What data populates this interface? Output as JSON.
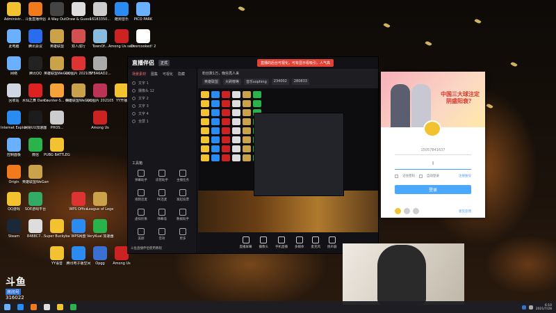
{
  "desktop": {
    "icons": [
      {
        "label": "Administr...",
        "color": "#f2c230",
        "col": 0,
        "row": 0
      },
      {
        "label": "斗鱼直播伴侣",
        "color": "#f07a1c",
        "col": 1,
        "row": 0
      },
      {
        "label": "A Way Out",
        "color": "#444",
        "col": 2,
        "row": 0
      },
      {
        "label": "Draw & Guess",
        "color": "#ddd",
        "col": 3,
        "row": 0
      },
      {
        "label": "16183350...",
        "color": "#ccc",
        "col": 4,
        "row": 0
      },
      {
        "label": "酷狗音乐",
        "color": "#2a8cf0",
        "col": 5,
        "row": 0
      },
      {
        "label": "PICO PARK",
        "color": "#6ab0ff",
        "col": 6,
        "row": 0
      },
      {
        "label": "此电脑",
        "color": "#6ab0ff",
        "col": 0,
        "row": 1
      },
      {
        "label": "腾讯会议",
        "color": "#2a6cf0",
        "col": 1,
        "row": 1
      },
      {
        "label": "英雄联盟",
        "color": "#c9a24a",
        "col": 2,
        "row": 1
      },
      {
        "label": "双人成行",
        "color": "#d35050",
        "col": 3,
        "row": 1
      },
      {
        "label": "TownOf...",
        "color": "#8bd",
        "col": 4,
        "row": 1
      },
      {
        "label": "Among Us sentian",
        "color": "#c22",
        "col": 5,
        "row": 1
      },
      {
        "label": "Overcooked! 2",
        "color": "#fff",
        "col": 6,
        "row": 1
      },
      {
        "label": "网络",
        "color": "#6ab0ff",
        "col": 0,
        "row": 2
      },
      {
        "label": "腾讯QQ",
        "color": "#222",
        "col": 1,
        "row": 2
      },
      {
        "label": "英雄联盟WeGame版",
        "color": "#c9a24a",
        "col": 2,
        "row": 2
      },
      {
        "label": "QQ图片 20210S...",
        "color": "#d33",
        "col": 3,
        "row": 2
      },
      {
        "label": "5F8A6AD2...",
        "color": "#aaa",
        "col": 4,
        "row": 2
      },
      {
        "label": "回收站",
        "color": "#cfd8e0",
        "col": 0,
        "row": 3
      },
      {
        "label": "水仙之舞 Dance of F...",
        "color": "#d22",
        "col": 1,
        "row": 3
      },
      {
        "label": "Counter-S... Global Of...",
        "color": "#f6a23a",
        "col": 2,
        "row": 3
      },
      {
        "label": "英雄联盟WeGame...",
        "color": "#c9a24a",
        "col": 3,
        "row": 3
      },
      {
        "label": "QQ图片 2021050...",
        "color": "#b35",
        "col": 4,
        "row": 3
      },
      {
        "label": "YY开播",
        "color": "#f2c230",
        "col": 5,
        "row": 3
      },
      {
        "label": "Internet Explorer",
        "color": "#2a8cf0",
        "col": 0,
        "row": 4
      },
      {
        "label": "网易UU加速器",
        "color": "#1c1c1c",
        "col": 1,
        "row": 4
      },
      {
        "label": "PHOS...",
        "color": "#ccc",
        "col": 2,
        "row": 4
      },
      {
        "label": "Among Us",
        "color": "#c22",
        "col": 4,
        "row": 4
      },
      {
        "label": "控制面板",
        "color": "#6ab0ff",
        "col": 0,
        "row": 5
      },
      {
        "label": "微信",
        "color": "#2ab34a",
        "col": 1,
        "row": 5
      },
      {
        "label": "PUBG BATTLEG...",
        "color": "#f2c230",
        "col": 2,
        "row": 5
      },
      {
        "label": "Origin",
        "color": "#f07a1c",
        "col": 0,
        "row": 6
      },
      {
        "label": "英雄联盟WeGame版",
        "color": "#c9a24a",
        "col": 1,
        "row": 6
      },
      {
        "label": "QQ游戏",
        "color": "#f2c230",
        "col": 0,
        "row": 7
      },
      {
        "label": "SOE游戏平台",
        "color": "#3a6",
        "col": 1,
        "row": 7
      },
      {
        "label": "WPS Office",
        "color": "#d33",
        "col": 3,
        "row": 7
      },
      {
        "label": "League of Legends",
        "color": "#c9a24a",
        "col": 4,
        "row": 7
      },
      {
        "label": "Steam",
        "color": "#1b2838",
        "col": 0,
        "row": 8
      },
      {
        "label": "8488C7...",
        "color": "#ddd",
        "col": 1,
        "row": 8
      },
      {
        "label": "Super Buckyball...",
        "color": "#f2c230",
        "col": 2,
        "row": 8
      },
      {
        "label": "WPS网盘",
        "color": "#2a8cf0",
        "col": 3,
        "row": 8
      },
      {
        "label": "VeryKuai 加速器",
        "color": "#2ab34a",
        "col": 4,
        "row": 8
      },
      {
        "label": "YY语音",
        "color": "#f2c230",
        "col": 2,
        "row": 9
      },
      {
        "label": "腾讯电子版空间",
        "color": "#2a8cf0",
        "col": 3,
        "row": 9
      },
      {
        "label": "Opgg",
        "color": "#3b6fd1",
        "col": 4,
        "row": 9
      },
      {
        "label": "Among Us",
        "color": "#c22",
        "col": 5,
        "row": 9
      }
    ]
  },
  "main_window": {
    "logo": "直播伴侣",
    "version": "正式",
    "promo": "直播的后台可视化，可有显示看吸引，人气高",
    "side_tabs": [
      "场景素材",
      "图集",
      "可视化",
      "隐藏"
    ],
    "scenes": [
      {
        "label": "文字 1"
      },
      {
        "label": "摄像头 12"
      },
      {
        "label": "文字 2"
      },
      {
        "label": "文字 3"
      },
      {
        "label": "文字 4"
      },
      {
        "label": "全屏 1"
      }
    ],
    "tools_title": "工具箱",
    "tools": [
      "弹幕助手",
      "房管助手",
      "主播任务",
      "视频连麦",
      "PK连麦",
      "发起投票",
      "虚拟形象",
      "弹幕墙",
      "数据助手",
      "美颜",
      "音效",
      "更多"
    ],
    "status_line": "粉丝数1万，晚些再人来",
    "chips": [
      "英雄联盟",
      "大刷榜等",
      "音乐sophing",
      "234002",
      "280833"
    ],
    "bottom_tools": [
      "直播屏幕",
      "摄像头",
      "手机直播",
      "多媒体",
      "麦克风",
      "扬声器"
    ],
    "footer_link": "斗鱼直播伴侣使用教程"
  },
  "login_popup": {
    "banner_text": "中国三大球注定阴盛阳衰？",
    "account": "15057841637",
    "password_cursor": "I",
    "remember": "记住密码",
    "auto_login": "自动登录",
    "register": "注册账号",
    "button": "登录",
    "feedback": "意见反馈"
  },
  "stream_overlay": {
    "brand": "斗鱼",
    "room_label": "房间号",
    "room_number": "316022"
  },
  "taskbar": {
    "time": "6:10",
    "date": "2021/7/28"
  },
  "colors": {
    "promo_red": "#e04336",
    "login_blue": "#4aa8ff"
  }
}
